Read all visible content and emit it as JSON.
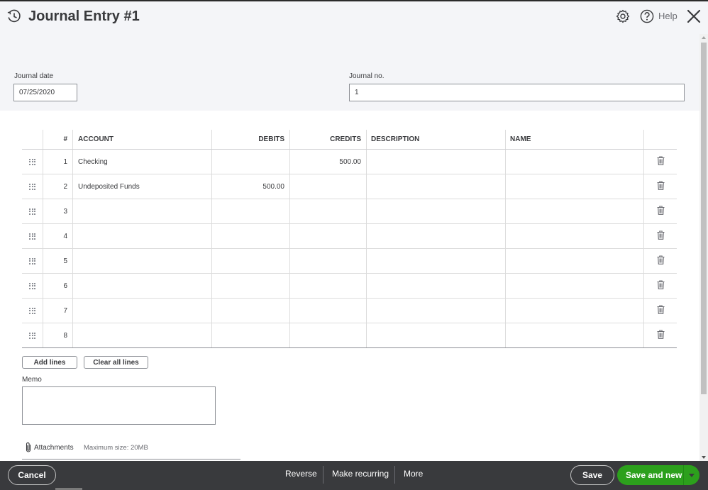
{
  "window": {
    "title": "Journal Entry #1",
    "help_label": "Help"
  },
  "form": {
    "journal_date_label": "Journal date",
    "journal_date_value": "07/25/2020",
    "journal_no_label": "Journal no.",
    "journal_no_value": "1"
  },
  "table": {
    "headers": {
      "num": "#",
      "account": "ACCOUNT",
      "debits": "DEBITS",
      "credits": "CREDITS",
      "description": "DESCRIPTION",
      "name": "NAME"
    },
    "rows": [
      {
        "num": "1",
        "account": "Checking",
        "debits": "",
        "credits": "500.00",
        "description": "",
        "name": ""
      },
      {
        "num": "2",
        "account": "Undeposited Funds",
        "debits": "500.00",
        "credits": "",
        "description": "",
        "name": ""
      },
      {
        "num": "3",
        "account": "",
        "debits": "",
        "credits": "",
        "description": "",
        "name": ""
      },
      {
        "num": "4",
        "account": "",
        "debits": "",
        "credits": "",
        "description": "",
        "name": ""
      },
      {
        "num": "5",
        "account": "",
        "debits": "",
        "credits": "",
        "description": "",
        "name": ""
      },
      {
        "num": "6",
        "account": "",
        "debits": "",
        "credits": "",
        "description": "",
        "name": ""
      },
      {
        "num": "7",
        "account": "",
        "debits": "",
        "credits": "",
        "description": "",
        "name": ""
      },
      {
        "num": "8",
        "account": "",
        "debits": "",
        "credits": "",
        "description": "",
        "name": ""
      }
    ]
  },
  "actions": {
    "add_lines": "Add lines",
    "clear_all_lines": "Clear all lines"
  },
  "memo": {
    "label": "Memo",
    "value": ""
  },
  "attachments": {
    "label": "Attachments",
    "hint": "Maximum size: 20MB"
  },
  "footer": {
    "cancel": "Cancel",
    "reverse": "Reverse",
    "make_recurring": "Make recurring",
    "more": "More",
    "save": "Save",
    "save_and_new": "Save and new"
  },
  "colors": {
    "primary_green": "#2ca01c",
    "footer_bg": "#393a3d",
    "header_bg": "#f4f5f8"
  },
  "icons": [
    "history-icon",
    "gear-icon",
    "help-icon",
    "close-icon",
    "drag-handle-icon",
    "trash-icon",
    "paperclip-icon",
    "caret-down-icon"
  ]
}
